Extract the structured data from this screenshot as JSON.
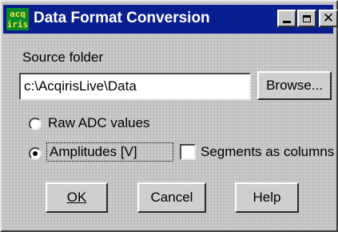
{
  "window": {
    "title": "Data Format Conversion",
    "icon": {
      "name": "acqiris-app-icon",
      "lines": [
        "acq",
        "iris"
      ]
    },
    "controls": {
      "minimize": "minimize-icon",
      "maximize": "maximize-icon",
      "close_glyph": "✕"
    }
  },
  "source": {
    "label": "Source folder",
    "value": "c:\\AcqirisLive\\Data",
    "browse_label": "Browse..."
  },
  "options": {
    "raw_label": "Raw ADC values",
    "raw_selected": false,
    "amplitudes_label": "Amplitudes [V]",
    "amplitudes_selected": true,
    "segments_label": "Segments as columns",
    "segments_checked": false
  },
  "buttons": {
    "ok_label": "OK",
    "cancel_label": "Cancel",
    "help_label": "Help"
  },
  "colors": {
    "titlebar": "#0a1f8f",
    "dialog_bg": "#c9c9c9"
  }
}
